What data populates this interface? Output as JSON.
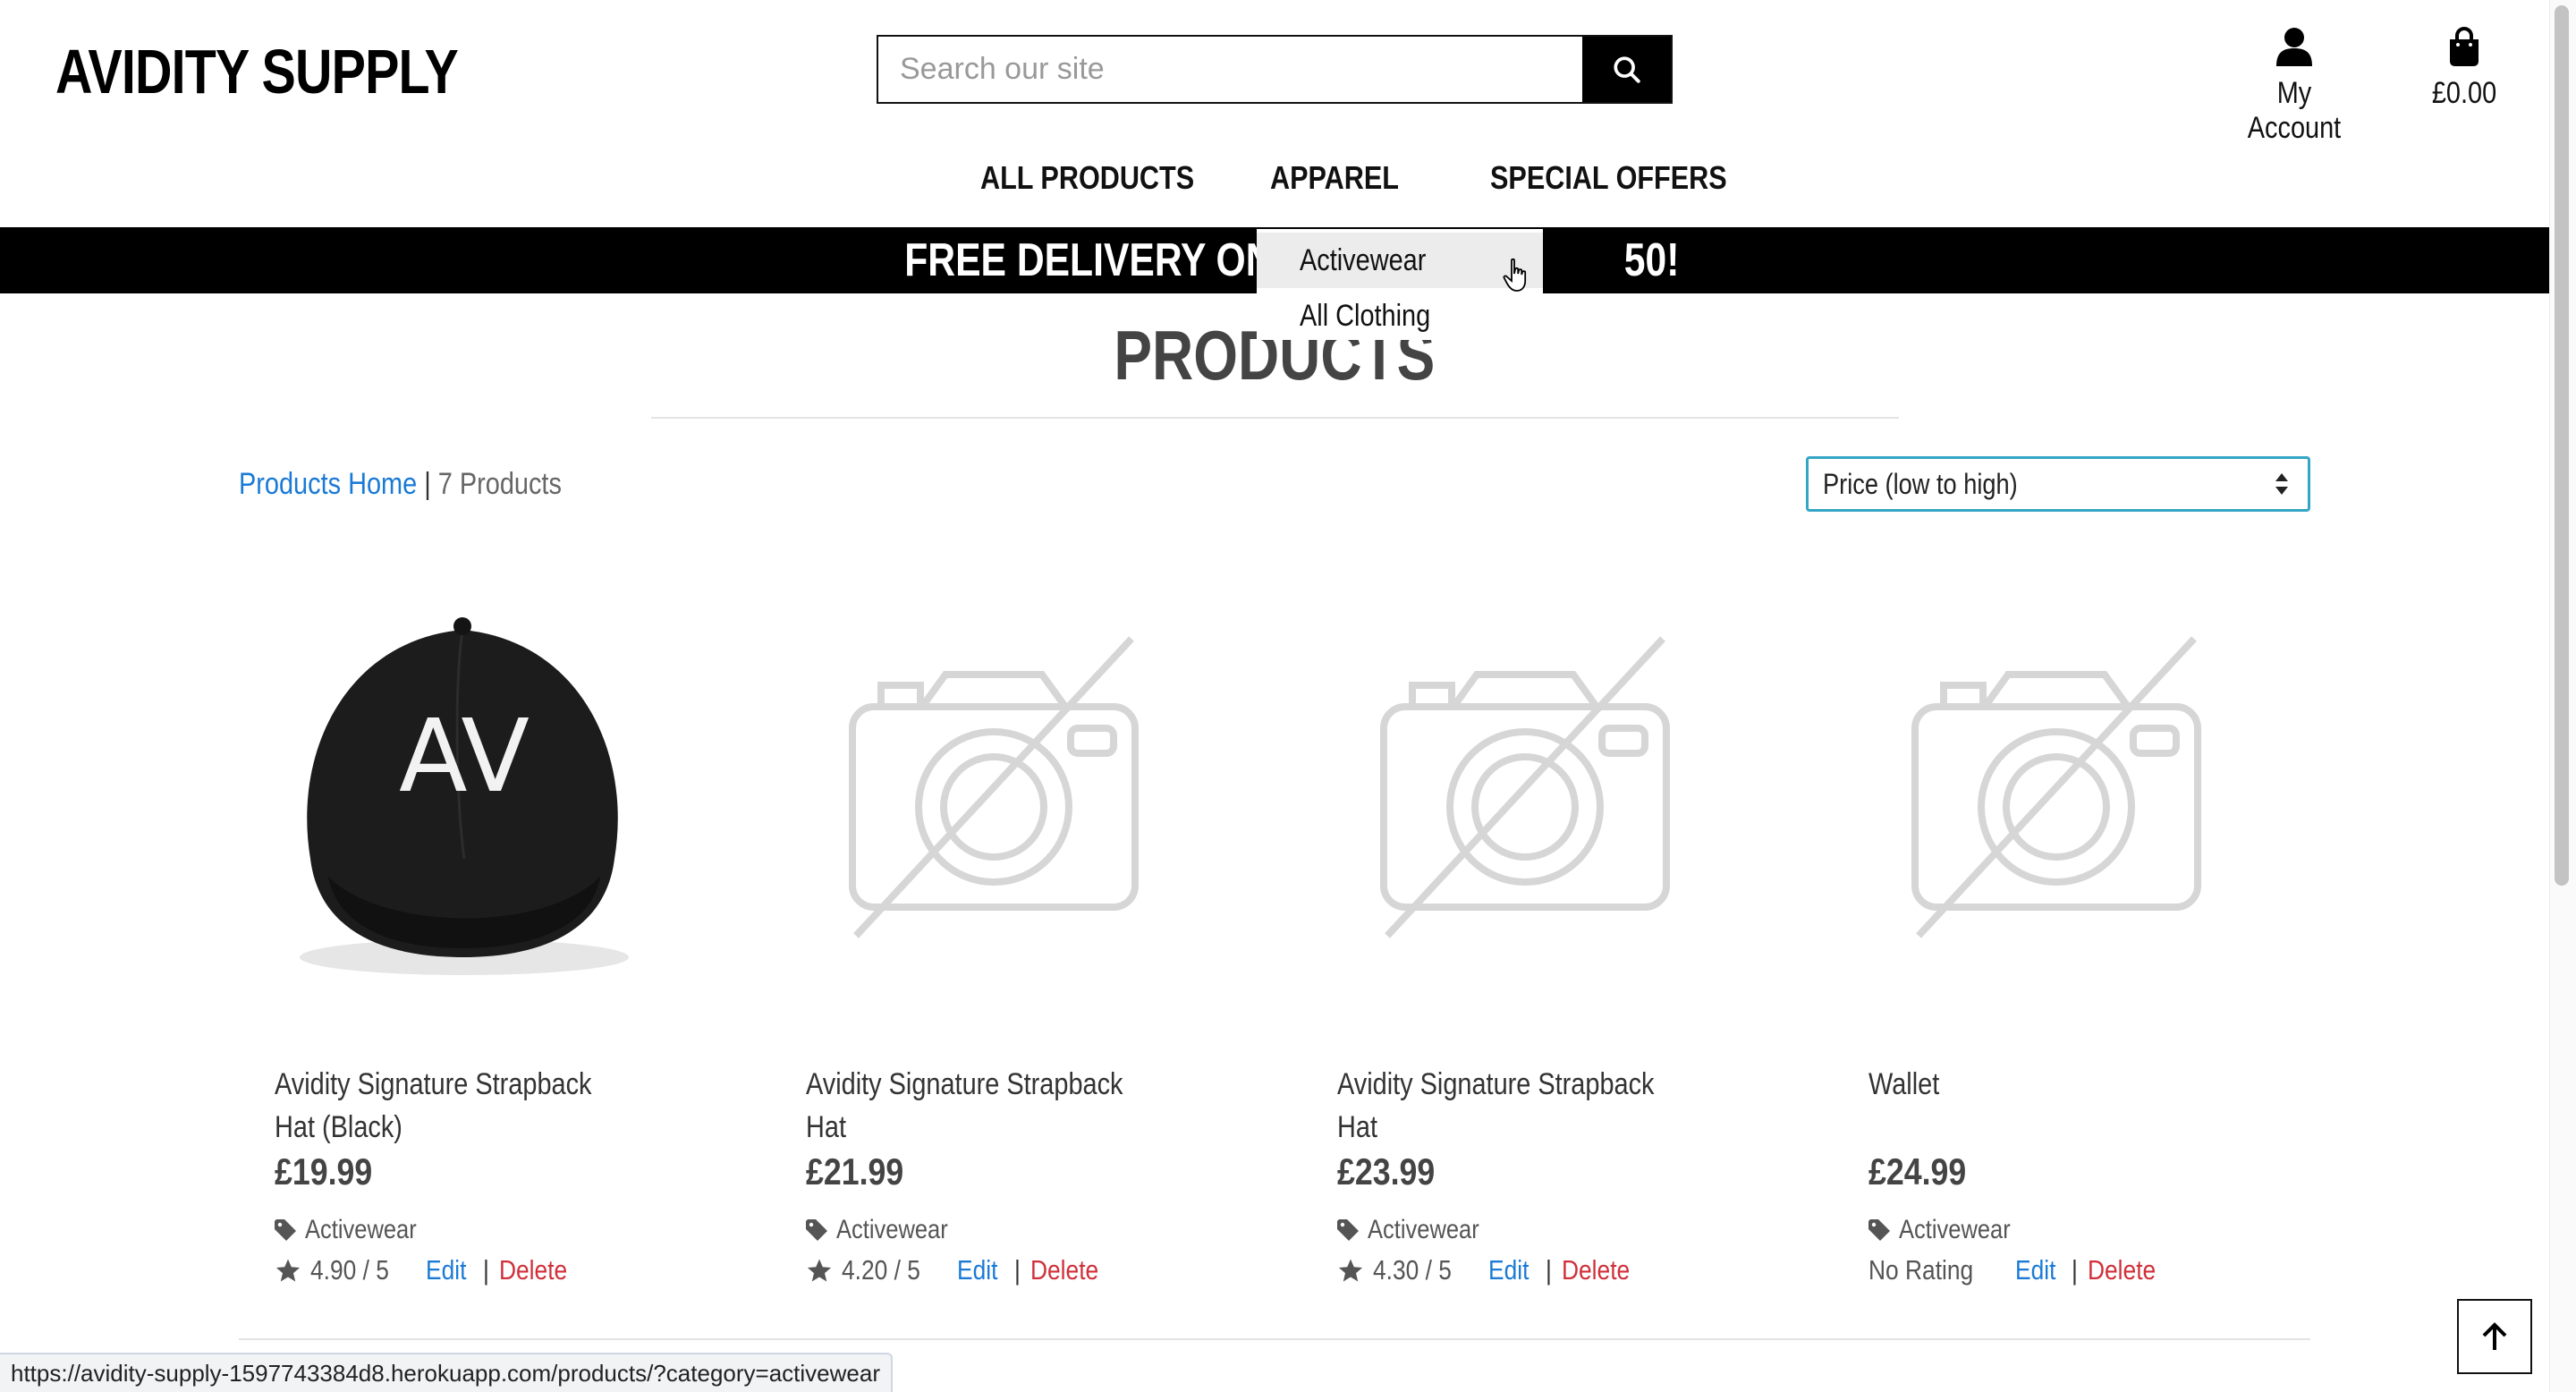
{
  "header": {
    "logo": "AVIDITY SUPPLY",
    "search_placeholder": "Search our site",
    "account_label": "My Account",
    "cart_total": "£0.00"
  },
  "nav": {
    "items": [
      "ALL PRODUCTS",
      "APPAREL",
      "SPECIAL OFFERS"
    ],
    "apparel_dropdown": [
      "Activewear",
      "All Clothing"
    ]
  },
  "banner": {
    "left_text": "FREE DELIVERY ON",
    "right_text": "50!"
  },
  "page": {
    "heading": "PRODUCTS",
    "breadcrumb_link": "Products Home",
    "separator": "|",
    "product_count": "7 Products",
    "sort_selected": "Price (low to high)"
  },
  "products": [
    {
      "name": "Avidity Signature Strapback Hat (Black)",
      "price": "£19.99",
      "category": "Activewear",
      "rating": "4.90 / 5",
      "edit": "Edit",
      "delete": "Delete",
      "image": "black-cap-av-logo"
    },
    {
      "name": "Avidity Signature Strapback Hat",
      "price": "£21.99",
      "category": "Activewear",
      "rating": "4.20 / 5",
      "edit": "Edit",
      "delete": "Delete",
      "image": "no-image-camera-icon"
    },
    {
      "name": "Avidity Signature Strapback Hat",
      "price": "£23.99",
      "category": "Activewear",
      "rating": "4.30 / 5",
      "edit": "Edit",
      "delete": "Delete",
      "image": "no-image-camera-icon"
    },
    {
      "name": "Wallet",
      "price": "£24.99",
      "category": "Activewear",
      "rating": "No Rating",
      "edit": "Edit",
      "delete": "Delete",
      "image": "no-image-camera-icon"
    }
  ],
  "cap_logo_text": "AV",
  "status_url": "https://avidity-supply-1597743384d8.herokuapp.com/products/?category=activewear",
  "colors": {
    "link": "#1a7ad6",
    "delete": "#d0303a",
    "banner": "#000000",
    "sort_border": "#34a6c5"
  }
}
